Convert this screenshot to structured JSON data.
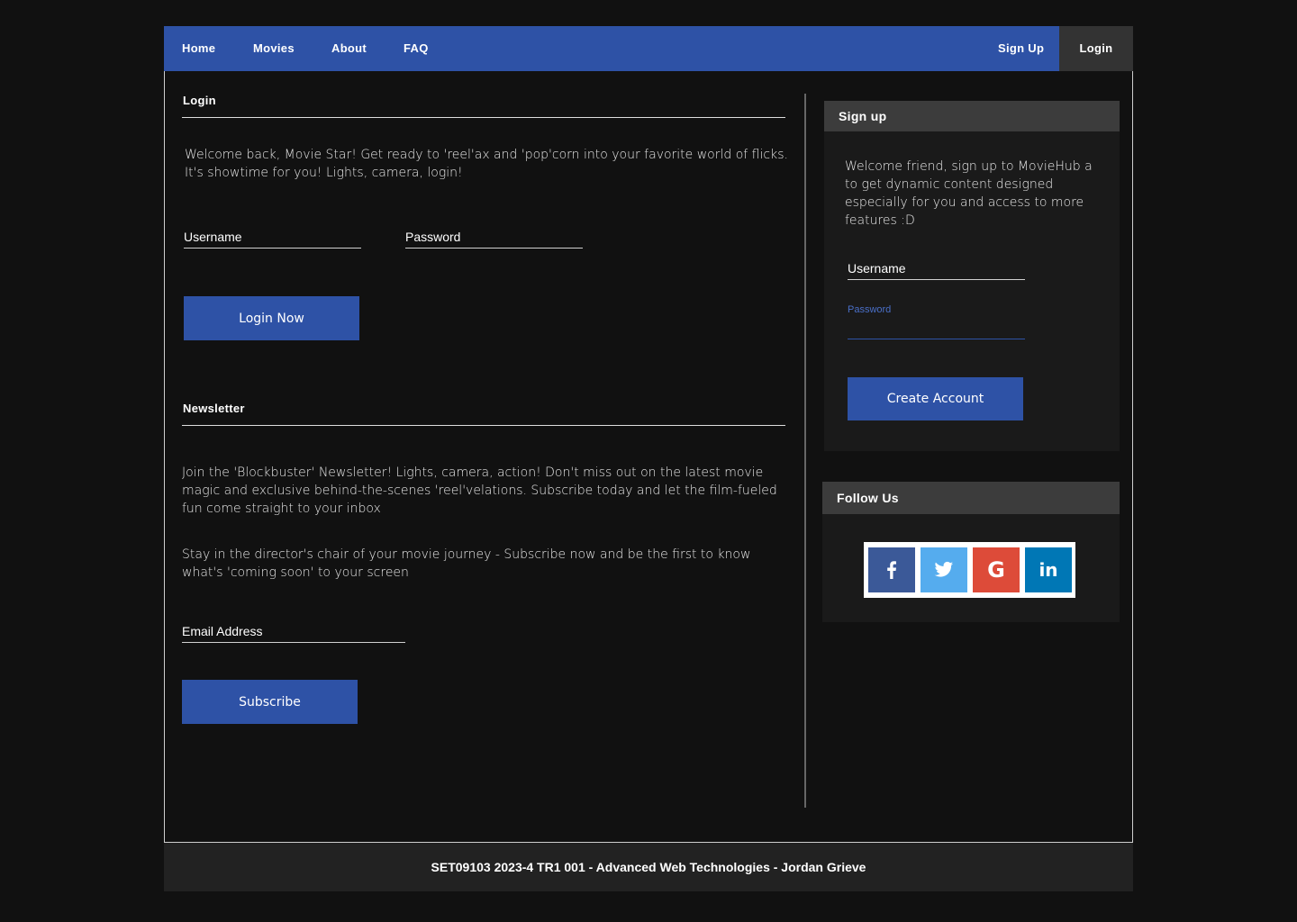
{
  "nav": {
    "home": "Home",
    "movies": "Movies",
    "about": "About",
    "faq": "FAQ",
    "signup": "Sign Up",
    "login": "Login"
  },
  "login": {
    "title": "Login",
    "text": "Welcome back, Movie Star! Get ready to 'reel'ax and 'pop'corn into your favorite world of flicks. It's showtime for you!  Lights, camera, login!",
    "username_placeholder": "Username",
    "password_placeholder": "Password",
    "button": "Login Now"
  },
  "newsletter": {
    "title": "Newsletter",
    "text1": "Join the 'Blockbuster' Newsletter! Lights, camera, action! Don't miss out on the latest movie magic and exclusive behind-the-scenes 'reel'velations. Subscribe today and let the film-fueled fun come straight to your inbox",
    "text2": "Stay in the director's chair of your movie journey - Subscribe now and be the first to know what's 'coming soon' to your screen",
    "email_placeholder": "Email Address",
    "button": "Subscribe"
  },
  "signup": {
    "title": "Sign up",
    "text": "Welcome friend, sign up to MovieHub a to get dynamic content designed especially for you and access to more features :D",
    "username_placeholder": "Username",
    "password_label": "Password",
    "button": "Create Account"
  },
  "follow": {
    "title": "Follow Us",
    "icons": [
      {
        "name": "facebook-icon",
        "glyph": "f",
        "color": "#3b5998"
      },
      {
        "name": "twitter-icon",
        "glyph": "t",
        "color": "#55acee"
      },
      {
        "name": "google-icon",
        "glyph": "G",
        "color": "#dd4b39"
      },
      {
        "name": "linkedin-icon",
        "glyph": "in",
        "color": "#0077b5"
      }
    ]
  },
  "footer": {
    "text": "SET09103 2023-4 TR1 001 - Advanced Web Technologies - Jordan Grieve"
  },
  "colors": {
    "accent": "#2e52a6",
    "background": "#111111",
    "panel_header": "#3c3c3c",
    "footer": "#222222"
  }
}
